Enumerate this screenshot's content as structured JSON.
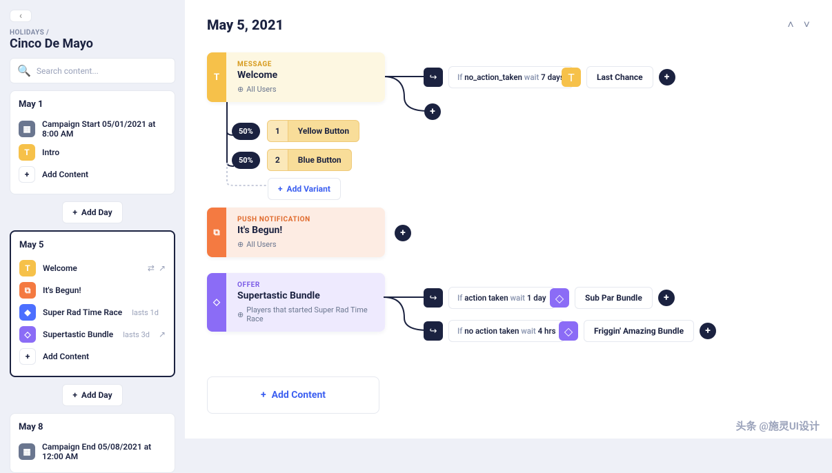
{
  "sidebar": {
    "breadcrumb": "HOLIDAYS /",
    "title": "Cinco De Mayo",
    "search_placeholder": "Search content...",
    "add_day_label": "Add Day",
    "days": [
      {
        "label": "May 1",
        "items": [
          {
            "icon": "calendar",
            "color": "slate",
            "text": "Campaign Start 05/01/2021 at 8:00 AM"
          },
          {
            "icon": "T",
            "color": "yellow",
            "text": "Intro"
          },
          {
            "icon": "+",
            "color": "outline",
            "text": "Add Content"
          }
        ]
      },
      {
        "label": "May 5",
        "selected": true,
        "items": [
          {
            "icon": "T",
            "color": "yellow",
            "text": "Welcome",
            "trail": "split-share"
          },
          {
            "icon": "□",
            "color": "orange",
            "text": "It's Begun!"
          },
          {
            "icon": "◆",
            "color": "blue",
            "text": "Super Rad Time Race",
            "sub": "lasts 1d"
          },
          {
            "icon": "◇",
            "color": "purple",
            "text": "Supertastic Bundle",
            "sub": "lasts 3d",
            "trail": "share"
          },
          {
            "icon": "+",
            "color": "outline",
            "text": "Add Content"
          }
        ]
      },
      {
        "label": "May 8",
        "items": [
          {
            "icon": "calendar",
            "color": "slate",
            "text": "Campaign End 05/08/2021 at 12:00 AM"
          }
        ]
      }
    ]
  },
  "main": {
    "date": "May 5, 2021",
    "add_content_label": "Add Content",
    "add_variant_label": "Add Variant",
    "nodes": {
      "message": {
        "kicker": "MESSAGE",
        "title": "Welcome",
        "audience": "All Users",
        "tab": "T",
        "variants": [
          {
            "pct": "50%",
            "num": "1",
            "label": "Yellow Button"
          },
          {
            "pct": "50%",
            "num": "2",
            "label": "Blue Button"
          }
        ],
        "branch": {
          "condition_pre": "If ",
          "condition_key": "no_action_taken",
          "condition_mid": " wait ",
          "condition_val": "7 days",
          "result": "Last Chance"
        }
      },
      "push": {
        "kicker": "PUSH NOTIFICATION",
        "title": "It's Begun!",
        "audience": "All Users"
      },
      "offer": {
        "kicker": "OFFER",
        "title": "Supertastic Bundle",
        "audience": "Players that started Super Rad Time Race",
        "branches": [
          {
            "pre": "If ",
            "key": "action taken",
            "mid": " wait ",
            "val": "1 day",
            "result": "Sub Par Bundle"
          },
          {
            "pre": "If ",
            "key": "no action taken",
            "mid": " wait ",
            "val": "4 hrs",
            "result": "Friggin' Amazing Bundle"
          }
        ]
      }
    }
  },
  "watermark": "头条 @施灵UI设计"
}
